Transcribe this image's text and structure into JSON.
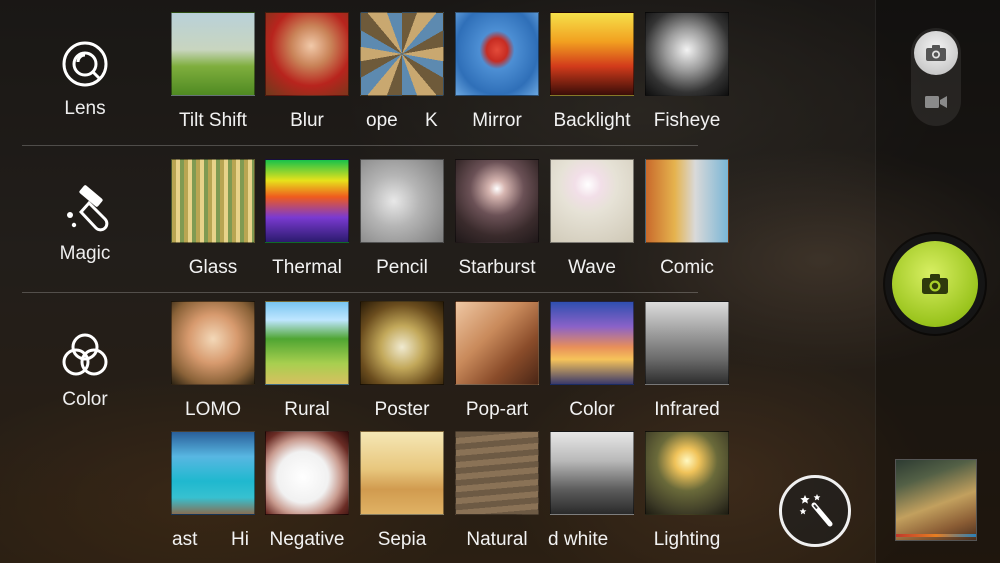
{
  "categories": [
    {
      "label": "Lens"
    },
    {
      "label": "Magic"
    },
    {
      "label": "Color"
    }
  ],
  "effect_rows": [
    {
      "items": [
        {
          "label": "Tilt Shift",
          "icon": "tilt-shift-thumbnail"
        },
        {
          "label": "Blur",
          "icon": "blur-thumbnail"
        },
        {
          "label": "ope",
          "icon": "kaleidoscope-thumbnail"
        },
        {
          "label": "K",
          "icon": "kaleidoscope-thumbnail"
        },
        {
          "label": "Mirror",
          "icon": "mirror-thumbnail"
        },
        {
          "label": "Backlight",
          "icon": "backlight-thumbnail"
        },
        {
          "label": "Fisheye",
          "icon": "fisheye-thumbnail"
        }
      ]
    },
    {
      "items": [
        {
          "label": "Glass",
          "icon": "glass-thumbnail"
        },
        {
          "label": "Thermal",
          "icon": "thermal-thumbnail"
        },
        {
          "label": "Pencil",
          "icon": "pencil-thumbnail"
        },
        {
          "label": "Starburst",
          "icon": "starburst-thumbnail"
        },
        {
          "label": "Wave",
          "icon": "wave-thumbnail"
        },
        {
          "label": "Comic",
          "icon": "comic-thumbnail"
        }
      ]
    },
    {
      "items": [
        {
          "label": "LOMO",
          "icon": "lomo-thumbnail"
        },
        {
          "label": "Rural",
          "icon": "rural-thumbnail"
        },
        {
          "label": "Poster",
          "icon": "poster-thumbnail"
        },
        {
          "label": "Pop-art",
          "icon": "pop-art-thumbnail"
        },
        {
          "label": "Color",
          "icon": "color-thumbnail"
        },
        {
          "label": "Infrared",
          "icon": "infrared-thumbnail"
        }
      ]
    },
    {
      "items": [
        {
          "label": "ast",
          "icon": "contrast-thumbnail"
        },
        {
          "label": "Hi",
          "icon": "contrast-thumbnail"
        },
        {
          "label": "Negative",
          "icon": "negative-thumbnail"
        },
        {
          "label": "Sepia",
          "icon": "sepia-thumbnail"
        },
        {
          "label": "Natural",
          "icon": "natural-thumbnail"
        },
        {
          "label": "d white",
          "icon": "black-and-white-thumbnail"
        },
        {
          "label": "Lighting",
          "icon": "lighting-thumbnail"
        }
      ]
    }
  ],
  "colors": {
    "shutter_accent": "#a9d12a"
  }
}
